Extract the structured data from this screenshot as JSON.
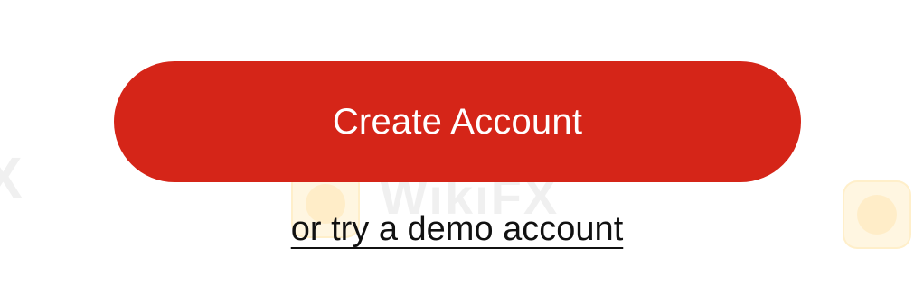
{
  "watermark": {
    "brand_text": "WikiFX",
    "fragment_left": "X"
  },
  "cta": {
    "label": "Create Account",
    "color": "#d52518"
  },
  "demo": {
    "link_text": "or try a demo account"
  }
}
